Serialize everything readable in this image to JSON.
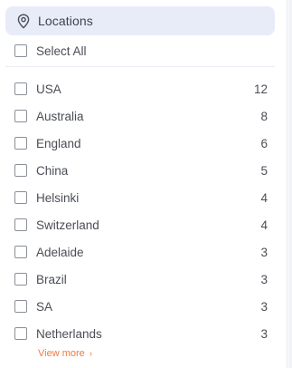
{
  "header": {
    "title": "Locations",
    "icon": "location-pin-icon"
  },
  "select_all": {
    "label": "Select All",
    "checked": false
  },
  "locations": [
    {
      "name": "USA",
      "count": "12",
      "checked": false
    },
    {
      "name": "Australia",
      "count": "8",
      "checked": false
    },
    {
      "name": "England",
      "count": "6",
      "checked": false
    },
    {
      "name": "China",
      "count": "5",
      "checked": false
    },
    {
      "name": "Helsinki",
      "count": "4",
      "checked": false
    },
    {
      "name": "Switzerland",
      "count": "4",
      "checked": false
    },
    {
      "name": "Adelaide",
      "count": "3",
      "checked": false
    },
    {
      "name": "Brazil",
      "count": "3",
      "checked": false
    },
    {
      "name": "SA",
      "count": "3",
      "checked": false
    },
    {
      "name": "Netherlands",
      "count": "3",
      "checked": false
    }
  ],
  "view_more": {
    "label": "View more",
    "icon": "chevron-right-icon"
  },
  "colors": {
    "header_bg": "#e8ecf8",
    "accent": "#f07a3f"
  }
}
